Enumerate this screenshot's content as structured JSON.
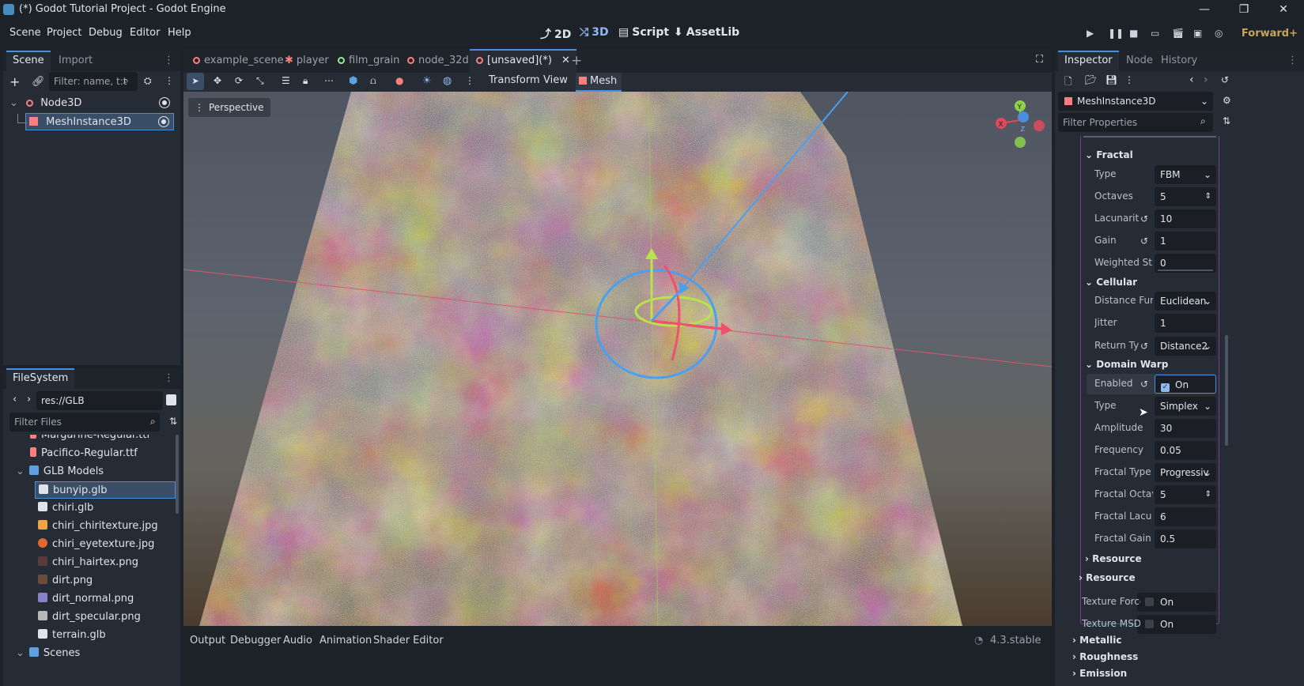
{
  "window": {
    "title": "(*) Godot Tutorial Project - Godot Engine",
    "minimize": "—",
    "maximize": "❐",
    "close": "✕"
  },
  "menu": {
    "items": [
      "Scene",
      "Project",
      "Debug",
      "Editor",
      "Help"
    ],
    "modes": [
      "2D",
      "3D",
      "Script",
      "AssetLib"
    ],
    "renderer": "Forward+"
  },
  "scene_dock": {
    "tabs": [
      "Scene",
      "Import"
    ],
    "filter_placeholder": "Filter: name, t:t",
    "tree": [
      "Node3D",
      "MeshInstance3D"
    ]
  },
  "filesystem_dock": {
    "tab": "FileSystem",
    "path": "res://GLB Models/bunyip.gl",
    "filter_placeholder": "Filter Files",
    "items": [
      "Margarine-Regular.ttf",
      "Pacifico-Regular.ttf",
      "GLB Models",
      "bunyip.glb",
      "chiri.glb",
      "chiri_chiritexture.jpg",
      "chiri_eyetexture.jpg",
      "chiri_hairtex.png",
      "dirt.png",
      "dirt_normal.png",
      "dirt_specular.png",
      "terrain.glb",
      "Scenes"
    ]
  },
  "editor_tabs": [
    "example_scene",
    "player",
    "film_grain",
    "node_32d",
    "[unsaved](*)"
  ],
  "viewport_toolbar": {
    "transform": "Transform",
    "view": "View",
    "mesh": "Mesh",
    "perspective": "Perspective"
  },
  "gizmo": {
    "y": "Y",
    "x": "X",
    "z": "Z"
  },
  "bottom_panel": {
    "tabs": [
      "Output",
      "Debugger",
      "Audio",
      "Animation",
      "Shader Editor"
    ],
    "version": "4.3.stable"
  },
  "inspector": {
    "tabs": [
      "Inspector",
      "Node",
      "History"
    ],
    "object": "MeshInstance3D",
    "filter_placeholder": "Filter Properties",
    "sections": {
      "fractal": "Fractal",
      "cellular": "Cellular",
      "domain_warp": "Domain Warp",
      "resource_inner": "Resource",
      "resource_outer": "Resource",
      "metallic": "Metallic",
      "roughness": "Roughness",
      "emission": "Emission"
    },
    "fractal": {
      "type_label": "Type",
      "type_value": "FBM",
      "octaves_label": "Octaves",
      "octaves_value": "5",
      "lacunarity_label": "Lacunarit",
      "lacunarity_value": "10",
      "gain_label": "Gain",
      "gain_value": "1",
      "weighted_label": "Weighted Str",
      "weighted_value": "0"
    },
    "cellular": {
      "distance_label": "Distance Fun",
      "distance_value": "Euclidean",
      "jitter_label": "Jitter",
      "jitter_value": "1",
      "return_label": "Return Ty",
      "return_value": "Distance2"
    },
    "domain_warp": {
      "enabled_label": "Enabled",
      "enabled_value": "On",
      "type_label": "Type",
      "type_value": "Simplex",
      "amplitude_label": "Amplitude",
      "amplitude_value": "30",
      "frequency_label": "Frequency",
      "frequency_value": "0.05",
      "fractal_type_label": "Fractal Type",
      "fractal_type_value": "Progressiv",
      "fractal_octaves_label": "Fractal Octav",
      "fractal_octaves_value": "5",
      "fractal_lacunarity_label": "Fractal Lacu",
      "fractal_lacunarity_value": "6",
      "fractal_gain_label": "Fractal Gain",
      "fractal_gain_value": "0.5"
    },
    "texture": {
      "force_label": "Texture Force s",
      "force_value": "On",
      "msdf_label": "Texture MSDF",
      "msdf_value": "On"
    }
  },
  "colors": {
    "accent": "#4b8ed9",
    "panel": "#262c35",
    "background": "#1d2229",
    "node_icon": "#fc7f7f",
    "renderer": "#c7a55b",
    "noise_dark": "#9a2d1c",
    "noise_light": "#f4e3b6"
  }
}
